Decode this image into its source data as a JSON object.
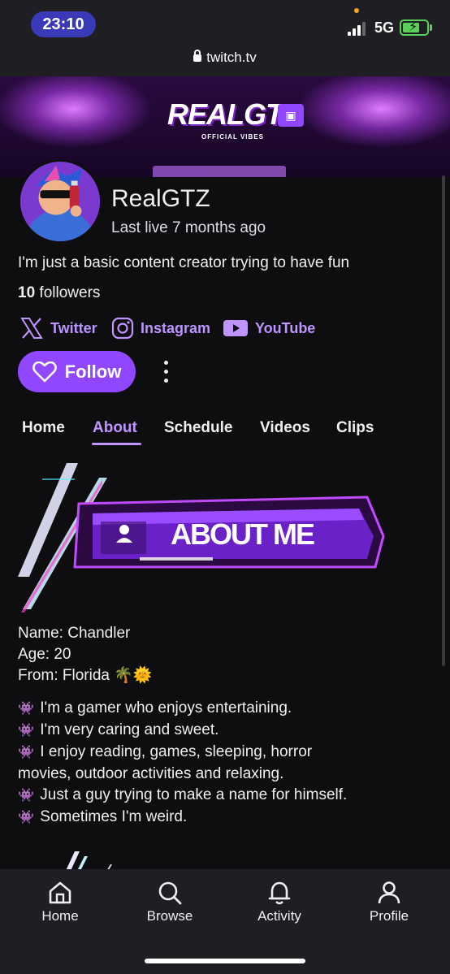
{
  "status_bar": {
    "time": "23:10",
    "network": "5G",
    "signal_level": 0.75,
    "battery_charging": true
  },
  "browser": {
    "url": "twitch.tv"
  },
  "banner": {
    "logo_text": "REALGTZ",
    "subtitle": "OFFICIAL VIBES"
  },
  "profile": {
    "name": "RealGTZ",
    "last_live": "Last live 7 months ago",
    "bio": "I'm just a basic content creator trying to have fun",
    "followers_count": "10",
    "followers_label": "followers"
  },
  "socials": [
    {
      "name": "Twitter",
      "icon": "x-icon"
    },
    {
      "name": "Instagram",
      "icon": "instagram-icon"
    },
    {
      "name": "YouTube",
      "icon": "youtube-icon"
    }
  ],
  "actions": {
    "follow_label": "Follow"
  },
  "tabs": [
    {
      "label": "Home",
      "active": false
    },
    {
      "label": "About",
      "active": true
    },
    {
      "label": "Schedule",
      "active": false
    },
    {
      "label": "Videos",
      "active": false
    },
    {
      "label": "Clips",
      "active": false
    }
  ],
  "about": {
    "graphic_text": "ABOUT ME",
    "info_lines": [
      "Name: Chandler",
      "Age: 20",
      "From: Florida 🌴🌞"
    ],
    "bullet_icon": "👾",
    "bullets": [
      "I'm a gamer who enjoys entertaining.",
      "I'm very caring and sweet.",
      "I enjoy reading, games, sleeping, horror",
      "movies, outdoor activities and relaxing.",
      "Just a guy trying to make a name for himself.",
      "Sometimes I'm weird."
    ]
  },
  "bottom_nav": [
    {
      "label": "Home",
      "icon": "home-icon"
    },
    {
      "label": "Browse",
      "icon": "search-icon"
    },
    {
      "label": "Activity",
      "icon": "bell-icon"
    },
    {
      "label": "Profile",
      "icon": "person-icon"
    }
  ],
  "colors": {
    "accent": "#9147ff",
    "accent_text": "#bf94ff",
    "background": "#0e0e10",
    "bar": "#1f1f23"
  }
}
